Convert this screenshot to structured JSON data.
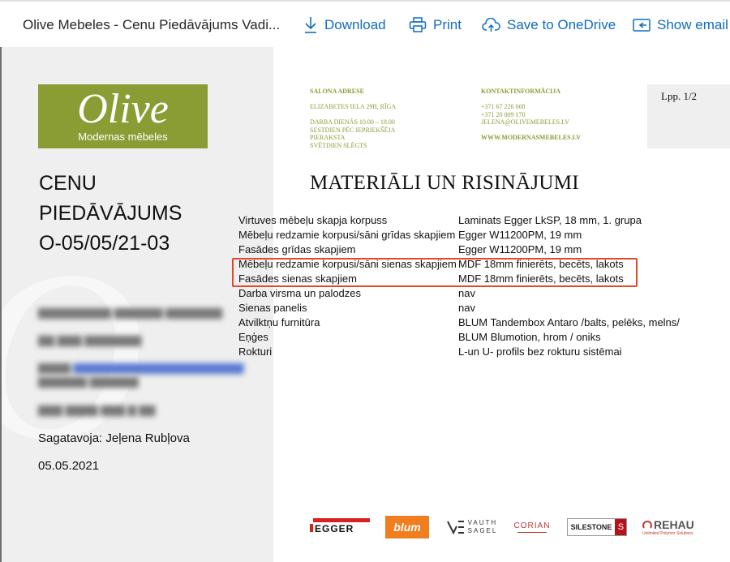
{
  "toolbar": {
    "doc_title": "Olive Mebeles - Cenu Piedāvājums Vadi...",
    "download_label": "Download",
    "print_label": "Print",
    "onedrive_label": "Save to OneDrive",
    "show_email_label": "Show email",
    "accent_color": "#0f6cbd"
  },
  "logo": {
    "wordmark": "Olive",
    "tagline": "Modernas mēbeles",
    "color": "#8a9d34"
  },
  "quote": {
    "title_lines": [
      "CENU",
      "PIEDĀVĀJUMS",
      "O-05/05/21-03"
    ],
    "prepared_by": "Sagatavoja: Jeļena Rubļova",
    "date": "05.05.2021"
  },
  "salon": {
    "heading": "SALONA ADRESE",
    "address": "ELIZABETES IELA 29B, RĪGA",
    "hours": [
      "DARBA DIENĀS 10.00 – 18.00",
      "SESTDIEN PĒC IEPRIEKŠĒJA",
      "PIERAKSTA",
      "SVĒTDIEN SLĒGTS"
    ]
  },
  "contact": {
    "heading": "KONTAKTINFORMĀCIJA",
    "phones": [
      "+371 67 226 668",
      "+371 20 009 170"
    ],
    "email": "JELENA@OLIVEMEBELES.LV",
    "website": "WWW.MODERNASMEBELES.LV"
  },
  "page_label": "Lpp. 1/2",
  "materials": {
    "title": "MATERIĀLI UN RISINĀJUMI",
    "rows": [
      {
        "label": "Virtuves mēbeļu skapja korpuss",
        "value": "Laminats Egger LkSP, 18 mm, 1. grupa"
      },
      {
        "label": "Mēbeļu redzamie korpusi/sāni grīdas skapjiem",
        "value": "Egger W11200PM, 19 mm"
      },
      {
        "label": "Fasādes grīdas skapjiem",
        "value": "Egger W11200PM, 19 mm"
      },
      {
        "label": "Mēbeļu redzamie korpusi/sāni sienas skapjiem",
        "value": "MDF 18mm finierēts, becēts, lakots"
      },
      {
        "label": "Fasādes sienas skapjiem",
        "value": "MDF 18mm finierēts, becēts, lakots"
      },
      {
        "label": "Darba virsma un palodzes",
        "value": "nav"
      },
      {
        "label": "Sienas panelis",
        "value": "nav"
      },
      {
        "label": "Atvilktņu furnitūra",
        "value": "BLUM Tandembox  Antaro /balts, pelēks, melns/"
      },
      {
        "label": "Eņģes",
        "value": "BLUM Blumotion, hrom / oniks"
      },
      {
        "label": "Rokturi",
        "value": "L-un U- profils bez rokturu sistēmai"
      }
    ]
  },
  "brands": {
    "egger": "EGGER",
    "blum": "blum",
    "vauth_1": "VAUTH",
    "vauth_2": "SAGEL",
    "corian": "CORIAN",
    "silestone": "SILESTONE",
    "rehau": "REHAU",
    "rehau_sub": "Unlimited Polymer Solutions"
  },
  "highlight_color": "#e04a2a"
}
